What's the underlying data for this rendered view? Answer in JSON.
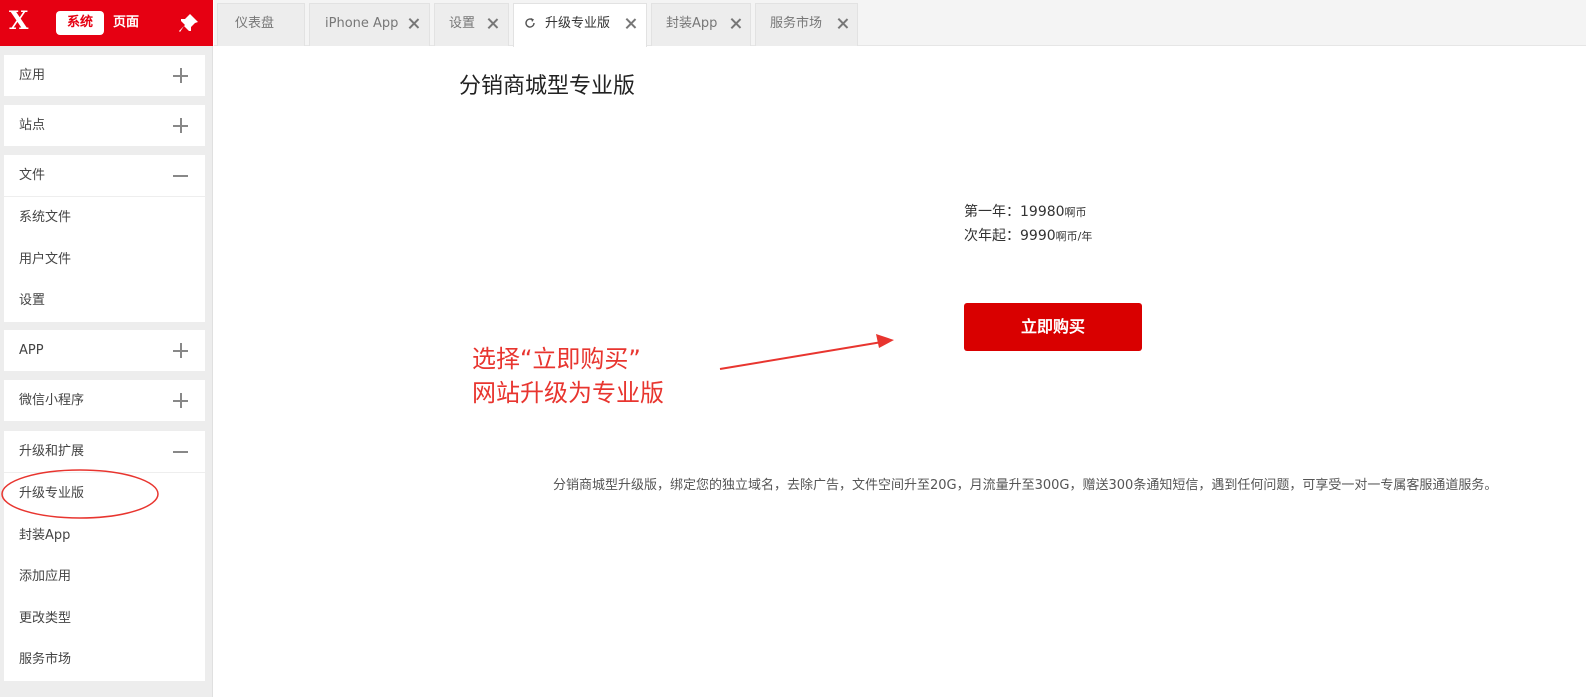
{
  "brand": {
    "logo": "X",
    "system_label": "系统",
    "page_label": "页面"
  },
  "sidebar": {
    "sections": [
      {
        "title": "应用",
        "state": "collapsed"
      },
      {
        "title": "站点",
        "state": "collapsed"
      },
      {
        "title": "文件",
        "state": "expanded",
        "items": [
          "系统文件",
          "用户文件",
          "设置"
        ]
      },
      {
        "title": "APP",
        "state": "collapsed"
      },
      {
        "title": "微信小程序",
        "state": "collapsed"
      },
      {
        "title": "升级和扩展",
        "state": "expanded",
        "items": [
          "升级专业版",
          "封装App",
          "添加应用",
          "更改类型",
          "服务市场"
        ]
      }
    ]
  },
  "tabs": [
    {
      "label": "仪表盘",
      "closable": false
    },
    {
      "label": "iPhone App",
      "closable": true
    },
    {
      "label": "设置",
      "closable": true
    },
    {
      "label": "升级专业版",
      "closable": true,
      "active": true
    },
    {
      "label": "封装App",
      "closable": true
    },
    {
      "label": "服务市场",
      "closable": true
    }
  ],
  "main": {
    "title": "分销商城型专业版",
    "price_first": {
      "label": "第一年：",
      "amount": "19980",
      "unit": "啊币"
    },
    "price_next": {
      "label": "次年起：",
      "amount": "9990",
      "unit": "啊币/年"
    },
    "buy_label": "立即购买",
    "description": "分销商城型升级版，绑定您的独立域名，去除广告，文件空间升至20G，月流量升至300G，赠送300条通知短信，遇到任何问题，可享受一对一专属客服通道服务。"
  },
  "annotation": {
    "line1": "选择“立即购买”",
    "line2": "网站升级为专业版",
    "color": "#e8352f"
  },
  "colors": {
    "brand_red": "#e60012",
    "buy_red": "#d90000"
  }
}
